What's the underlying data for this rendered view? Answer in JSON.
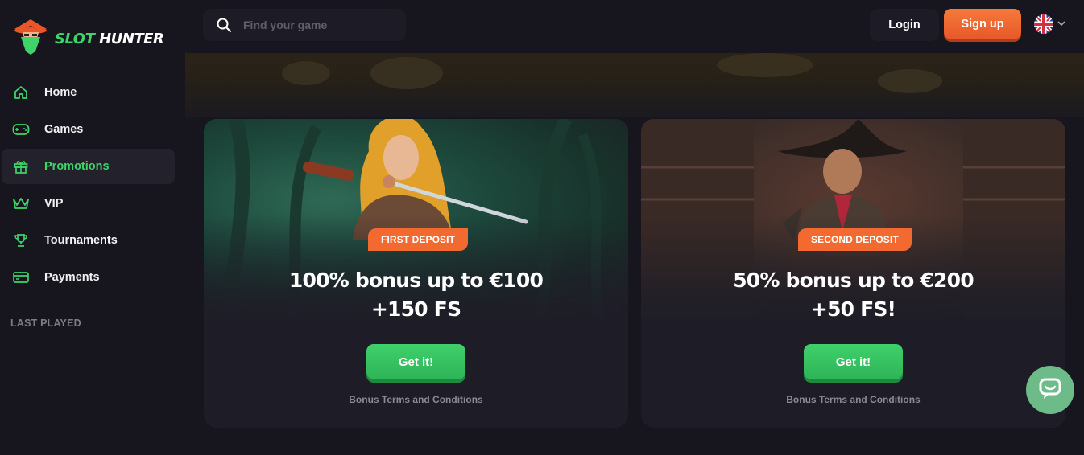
{
  "brand": {
    "name_part1": "SLOT",
    "name_part2": "HUNTER"
  },
  "search": {
    "placeholder": "Find your game"
  },
  "header": {
    "login_label": "Login",
    "signup_label": "Sign up"
  },
  "sidebar": {
    "items": [
      {
        "label": "Home",
        "icon": "home-icon",
        "active": false
      },
      {
        "label": "Games",
        "icon": "gamepad-icon",
        "active": false
      },
      {
        "label": "Promotions",
        "icon": "gift-icon",
        "active": true
      },
      {
        "label": "VIP",
        "icon": "crown-icon",
        "active": false
      },
      {
        "label": "Tournaments",
        "icon": "trophy-icon",
        "active": false
      },
      {
        "label": "Payments",
        "icon": "card-icon",
        "active": false
      }
    ],
    "section_label": "LAST PLAYED"
  },
  "promos": [
    {
      "badge": "FIRST DEPOSIT",
      "line1": "100% bonus up to €100",
      "line2": "+150 FS",
      "cta": "Get it!",
      "terms": "Bonus Terms and Conditions"
    },
    {
      "badge": "SECOND DEPOSIT",
      "line1": "50% bonus up to €200",
      "line2": "+50 FS!",
      "cta": "Get it!",
      "terms": "Bonus Terms and Conditions"
    }
  ],
  "colors": {
    "accent_green": "#3ed46a",
    "accent_orange": "#f26a30",
    "background": "#17161f"
  }
}
